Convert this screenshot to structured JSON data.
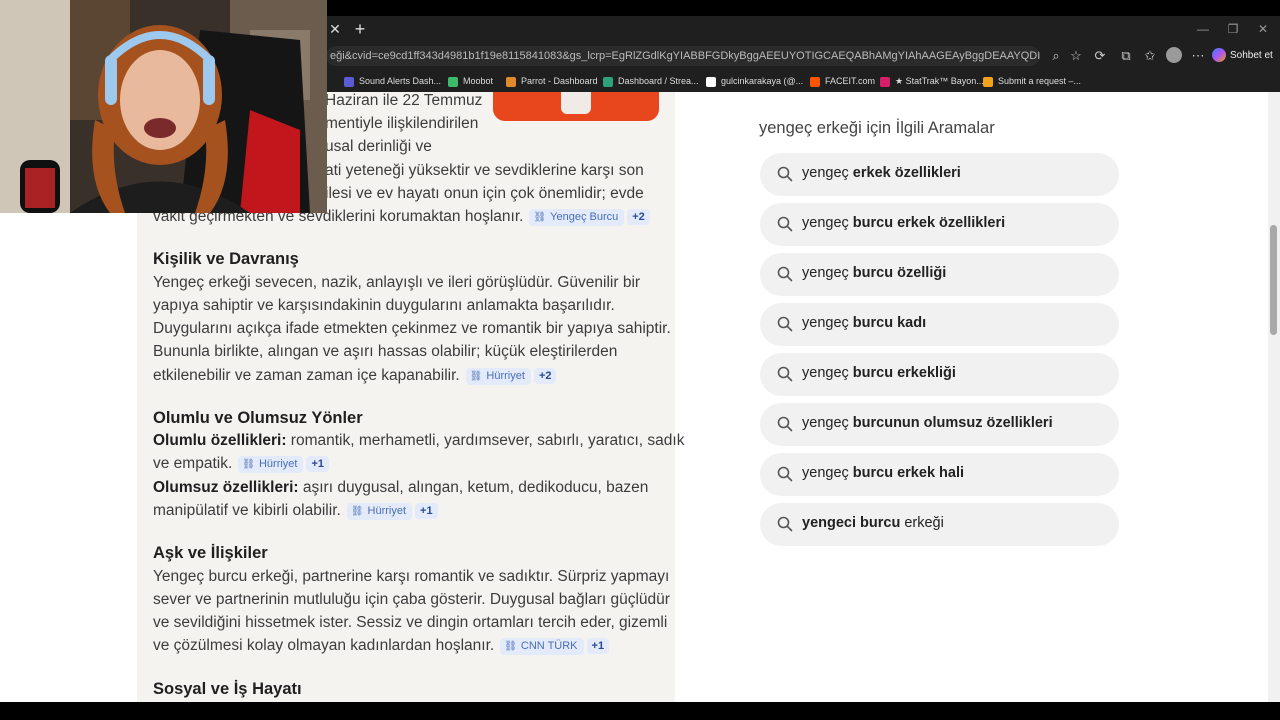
{
  "browser": {
    "url": "eği&cvid=ce9cd1ff343d4981b1f19e8115841083&gs_lcrp=EgRlZGdlKgYIABBFGDkyBggAEEUYOTIGCAEQABhAMgYIAhAAGEAyBggDEAAYQDIGCAQQABhAMgYIBRAAGEAyBg...",
    "copilot_label": "Sohbet et",
    "bookmarks": [
      {
        "label": "Sound Alerts Dash...",
        "color": "#5b5bd6"
      },
      {
        "label": "Moobot",
        "color": "#3dbb6a"
      },
      {
        "label": "Parrot - Dashboard",
        "color": "#e08a2c"
      },
      {
        "label": "Dashboard / Strea...",
        "color": "#2ea37a"
      },
      {
        "label": "gulcinkarakaya (@...",
        "color": "#ffffff"
      },
      {
        "label": "FACEIT.com",
        "color": "#ff5500"
      },
      {
        "label": "★ StatTrak™ Bayon...",
        "color": "#d61f6a"
      },
      {
        "label": "Submit a request –...",
        "color": "#f3a21b"
      }
    ]
  },
  "article": {
    "intro_lines": [
      "Haziran ile 22 Temmuz",
      "mentiyle ilişkilendirilen",
      "usal derinliği ve",
      "ati yeteneği yüksektir ve sevdiklerine karşı son",
      "ilesi ve ev hayatı onun için çok önemlidir; evde",
      "vakit geçirmekten ve sevdiklerini korumaktan hoşlanır."
    ],
    "intro_chip": {
      "label": "Yengeç Burcu",
      "plus": "+2"
    },
    "s1": {
      "heading": "Kişilik ve Davranış",
      "lines": [
        "Yengeç erkeği sevecen, nazik, anlayışlı ve ileri görüşlüdür. Güvenilir bir",
        "yapıya sahiptir ve karşısındakinin duygularını anlamakta başarılıdır.",
        "Duygularını açıkça ifade etmekten çekinmez ve romantik bir yapıya sahiptir.",
        "Bununla birlikte, alıngan ve aşırı hassas olabilir; küçük eleştirilerden",
        "etkilenebilir ve zaman zaman içe kapanabilir."
      ],
      "chip": {
        "label": "Hürriyet",
        "plus": "+2"
      }
    },
    "s2": {
      "heading": "Olumlu ve Olumsuz Yönler",
      "pos_label": "Olumlu özellikleri:",
      "pos_text": " romantik, merhametli, yardımsever, sabırlı, yaratıcı, sadık",
      "pos_text2": "ve empatik.",
      "pos_chip": {
        "label": "Hürriyet",
        "plus": "+1"
      },
      "neg_label": "Olumsuz özellikleri:",
      "neg_text": " aşırı duygusal, alıngan, ketum, dedikoducu, bazen",
      "neg_text2": "manipülatif ve kibirli olabilir.",
      "neg_chip": {
        "label": "Hürriyet",
        "plus": "+1"
      }
    },
    "s3": {
      "heading": "Aşk ve İlişkiler",
      "lines": [
        "Yengeç burcu erkeği, partnerine karşı romantik ve sadıktır. Sürpriz yapmayı",
        "sever ve partnerinin mutluluğu için çaba gösterir. Duygusal bağları güçlüdür",
        "ve sevildiğini hissetmek ister. Sessiz ve dingin ortamları tercih eder, gizemli",
        "ve çözülmesi kolay olmayan kadınlardan hoşlanır."
      ],
      "chip": {
        "label": "CNN TÜRK",
        "plus": "+1"
      }
    },
    "s4": {
      "heading": "Sosyal ve İş Hayatı"
    }
  },
  "related": {
    "title": "yengeç erkeği için İlgili Aramalar",
    "items": [
      {
        "pre": "yengeç ",
        "bold": "erkek özellikleri",
        "post": ""
      },
      {
        "pre": "yengeç ",
        "bold": "burcu erkek özellikleri",
        "post": ""
      },
      {
        "pre": "yengeç ",
        "bold": "burcu özelliği",
        "post": ""
      },
      {
        "pre": "yengeç ",
        "bold": "burcu kadı",
        "post": ""
      },
      {
        "pre": "yengeç ",
        "bold": "burcu erkekliği",
        "post": ""
      },
      {
        "pre": "yengeç ",
        "bold": "burcunun olumsuz özellikleri",
        "post": ""
      },
      {
        "pre": "yengeç ",
        "bold": "burcu erkek hali",
        "post": ""
      },
      {
        "pre": "",
        "bold": "yengeci burcu",
        "post": " erkeği"
      }
    ]
  }
}
